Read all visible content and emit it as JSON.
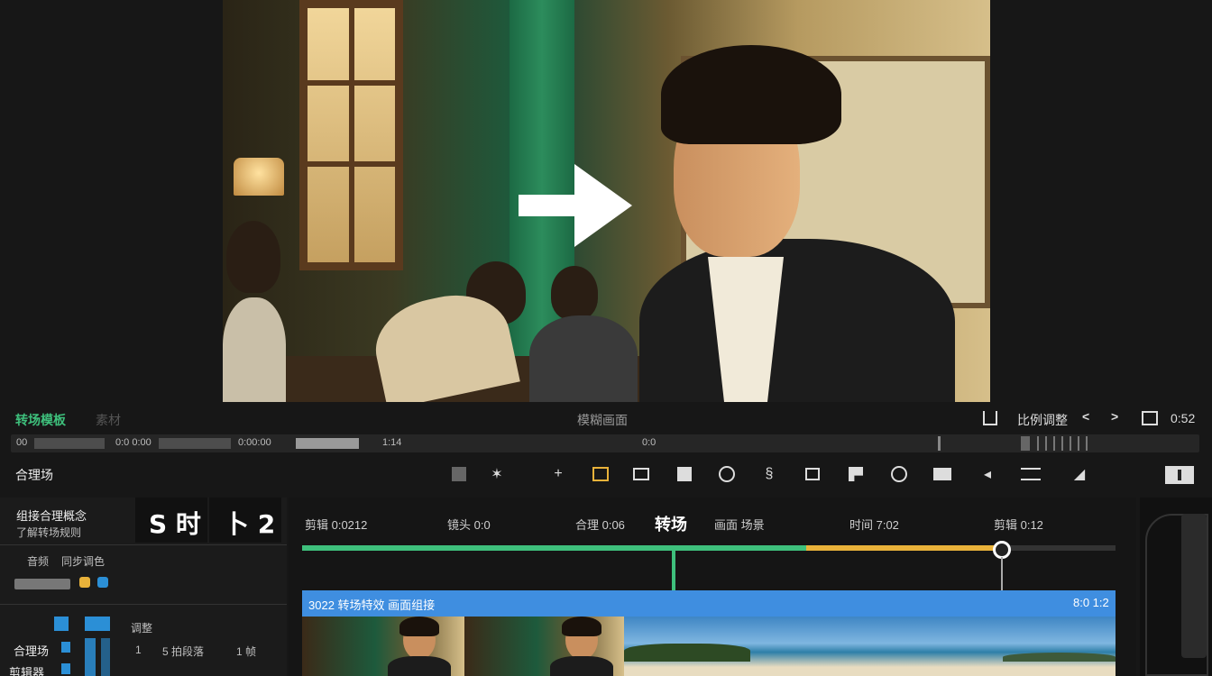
{
  "top_strip": {
    "title": "转场模板",
    "title_dim": "素材",
    "center": "模糊画面",
    "right": "比例调整",
    "right_end": "0:52",
    "left_arrow": "<",
    "right_arrow": ">"
  },
  "ruler": {
    "t1": "00",
    "t2": "0:0 0:00",
    "t3": "0:00:00",
    "t4": "1:14",
    "t5": "0:0"
  },
  "toolbar": {
    "label": "合理场",
    "add": "+"
  },
  "left_panel": {
    "heading": "组接合理概念",
    "sub": "了解转场规则",
    "row_a": "音频",
    "row_a2": "同步调色",
    "big_left": "S 时",
    "big_right": "卜 2",
    "grp_label": "调整",
    "items": [
      {
        "label": "合理场"
      },
      {
        "label": "剪辑器"
      }
    ],
    "tags": [
      "1",
      "5 拍段落",
      "1 帧"
    ]
  },
  "timeline": {
    "markers": [
      "剪辑 0:0212",
      "镜头 0:0",
      "合理 0:06",
      "转场",
      "画面 场景",
      "时间 7:02",
      "剪辑 0:12"
    ],
    "clip_title": "3022 转场特效 画面组接",
    "clip_end": "8:0 1:2",
    "progress": {
      "green": 0.62,
      "yellow": 0.86
    }
  },
  "colors": {
    "accent_green": "#3ec07c",
    "accent_yellow": "#e9b23a",
    "clip_blue": "#3f8ee0"
  }
}
